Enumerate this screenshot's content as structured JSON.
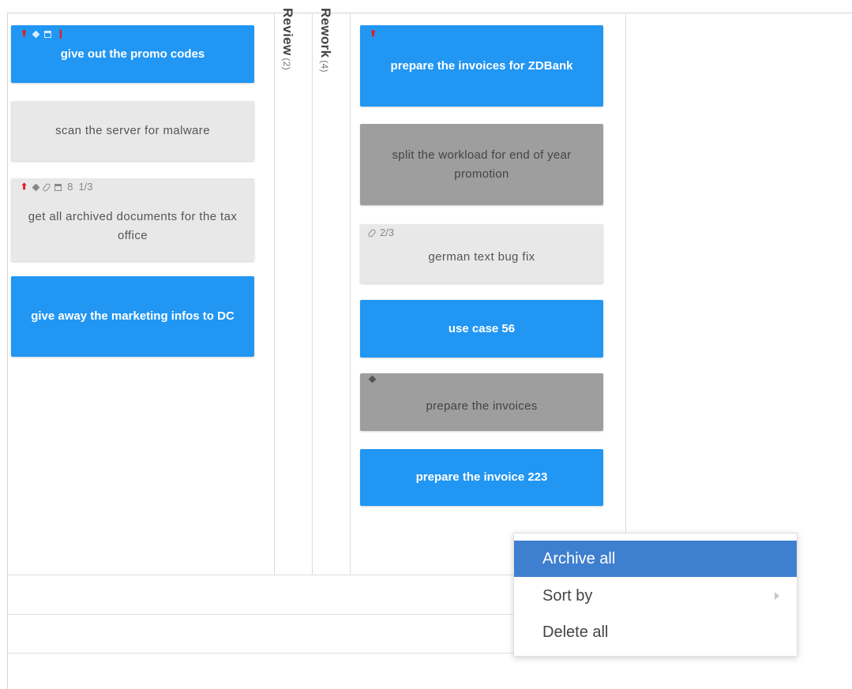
{
  "columns": {
    "review": {
      "label": "Review",
      "count": "(2)"
    },
    "rework": {
      "label": "Rework",
      "count": "(4)"
    }
  },
  "left_cards": [
    {
      "title": "give out the promo codes"
    },
    {
      "title": "scan the server for malware"
    },
    {
      "title": "get all archived documents for the tax office",
      "count_text": "8",
      "progress_text": "1/3"
    },
    {
      "title": "give away the marketing infos to DC"
    }
  ],
  "rework_cards": [
    {
      "title": "prepare the invoices for ZDBank"
    },
    {
      "title": "split the workload for end of year promotion"
    },
    {
      "title": "german text bug fix",
      "progress_text": "2/3"
    },
    {
      "title": "use case 56"
    },
    {
      "title": "prepare the invoices"
    },
    {
      "title": "prepare the invoice 223"
    }
  ],
  "context_menu": {
    "items": [
      {
        "label": "Archive all"
      },
      {
        "label": "Sort by"
      },
      {
        "label": "Delete all"
      }
    ]
  },
  "colors": {
    "card_blue": "#2196f3",
    "card_light": "#e8e8e8",
    "card_dark": "#9e9e9e",
    "menu_highlight": "#3f7fcf",
    "priority_red": "#e02020"
  }
}
